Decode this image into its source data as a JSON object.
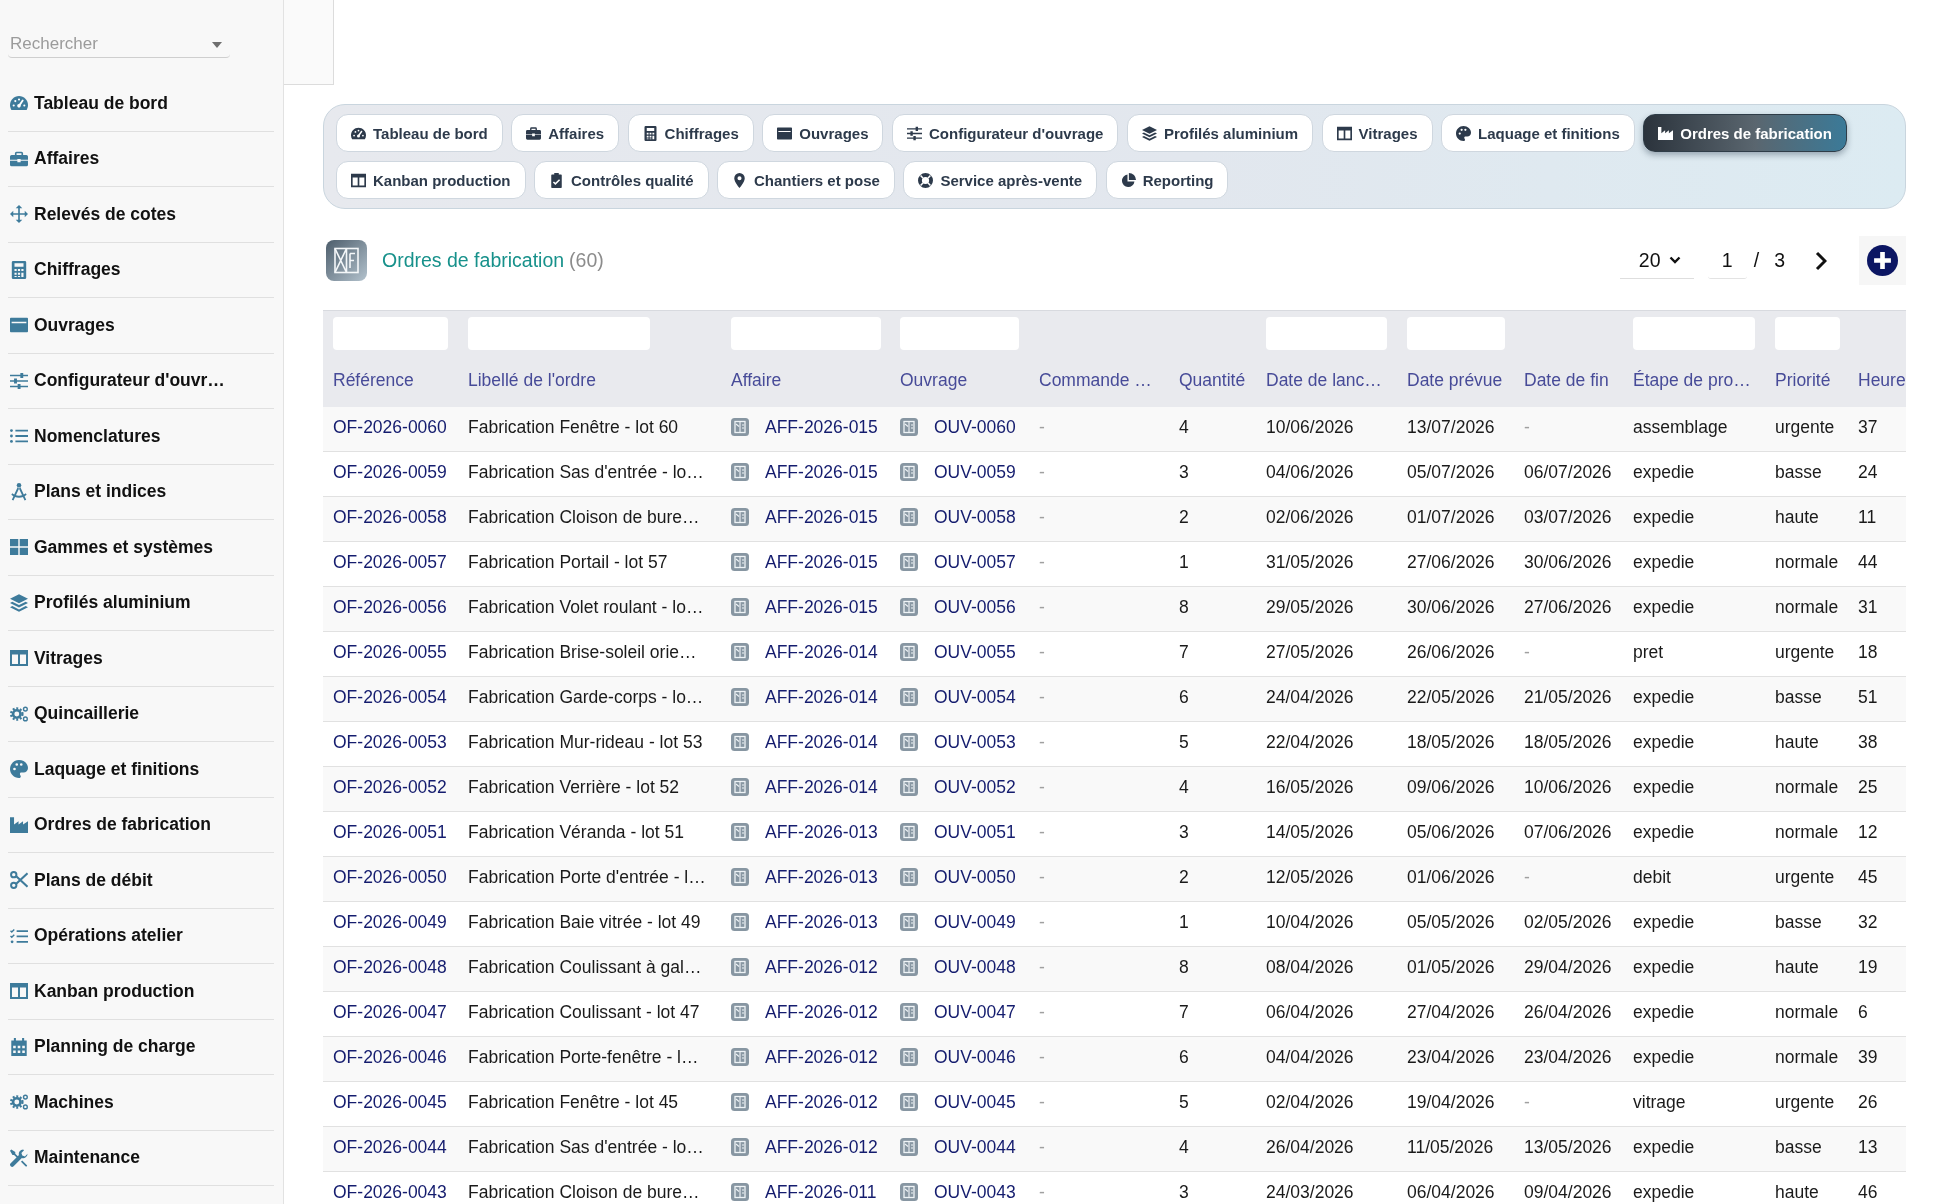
{
  "sidebar": {
    "search": {
      "placeholder": "Rechercher"
    },
    "items": [
      {
        "label": "Tableau de bord"
      },
      {
        "label": "Affaires"
      },
      {
        "label": "Relevés de cotes"
      },
      {
        "label": "Chiffrages"
      },
      {
        "label": "Ouvrages"
      },
      {
        "label": "Configurateur d'ouvr…"
      },
      {
        "label": "Nomenclatures"
      },
      {
        "label": "Plans et indices"
      },
      {
        "label": "Gammes et systèmes"
      },
      {
        "label": "Profilés aluminium"
      },
      {
        "label": "Vitrages"
      },
      {
        "label": "Quincaillerie"
      },
      {
        "label": "Laquage et finitions"
      },
      {
        "label": "Ordres de fabrication"
      },
      {
        "label": "Plans de débit"
      },
      {
        "label": "Opérations atelier"
      },
      {
        "label": "Kanban production"
      },
      {
        "label": "Planning de charge"
      },
      {
        "label": "Machines"
      },
      {
        "label": "Maintenance"
      }
    ]
  },
  "tabs": [
    {
      "label": "Tableau de bord",
      "selected": false
    },
    {
      "label": "Affaires",
      "selected": false
    },
    {
      "label": "Chiffrages",
      "selected": false
    },
    {
      "label": "Ouvrages",
      "selected": false
    },
    {
      "label": "Configurateur d'ouvrage",
      "selected": false
    },
    {
      "label": "Profilés aluminium",
      "selected": false
    },
    {
      "label": "Vitrages",
      "selected": false
    },
    {
      "label": "Laquage et finitions",
      "selected": false
    },
    {
      "label": "Ordres de fabrication",
      "selected": true
    },
    {
      "label": "Kanban production",
      "selected": false
    },
    {
      "label": "Contrôles qualité",
      "selected": false
    },
    {
      "label": "Chantiers et pose",
      "selected": false
    },
    {
      "label": "Service après-vente",
      "selected": false
    },
    {
      "label": "Reporting",
      "selected": false
    }
  ],
  "list_header": {
    "title": "Ordres de fabrication",
    "count": "(60)"
  },
  "pagination": {
    "page_size": "20",
    "page": "1",
    "separator": "/",
    "total_pages": "3"
  },
  "table": {
    "columns": [
      {
        "label": "Référence",
        "kind": "link",
        "filter": true
      },
      {
        "label": "Libellé de l'ordre",
        "kind": "text",
        "filter": true
      },
      {
        "label": "Affaire",
        "kind": "record",
        "filter": true
      },
      {
        "label": "Ouvrage",
        "kind": "record",
        "filter": true
      },
      {
        "label": "Commande …",
        "kind": "text",
        "filter": false
      },
      {
        "label": "Quantité",
        "kind": "text",
        "filter": false
      },
      {
        "label": "Date de lanc…",
        "kind": "text",
        "filter": true
      },
      {
        "label": "Date prévue",
        "kind": "text",
        "filter": true
      },
      {
        "label": "Date de fin",
        "kind": "text",
        "filter": false
      },
      {
        "label": "Étape de pro…",
        "kind": "text",
        "filter": true
      },
      {
        "label": "Priorité",
        "kind": "text",
        "filter": true
      },
      {
        "label": "Heure",
        "kind": "text",
        "filter": false
      }
    ],
    "rows": [
      {
        "cells": [
          "OF-2026-0060",
          "Fabrication Fenêtre - lot 60",
          "AFF-2026-015",
          "OUV-0060",
          "-",
          "4",
          "10/06/2026",
          "13/07/2026",
          "-",
          "assemblage",
          "urgente",
          "37"
        ],
        "muted": [
          false,
          false,
          false,
          false,
          true,
          false,
          false,
          false,
          true,
          false,
          false,
          false
        ]
      },
      {
        "cells": [
          "OF-2026-0059",
          "Fabrication Sas d'entrée - lo…",
          "AFF-2026-015",
          "OUV-0059",
          "-",
          "3",
          "04/06/2026",
          "05/07/2026",
          "06/07/2026",
          "expedie",
          "basse",
          "24"
        ],
        "muted": [
          false,
          false,
          false,
          false,
          true,
          false,
          false,
          false,
          false,
          false,
          false,
          false
        ]
      },
      {
        "cells": [
          "OF-2026-0058",
          "Fabrication Cloison de bure…",
          "AFF-2026-015",
          "OUV-0058",
          "-",
          "2",
          "02/06/2026",
          "01/07/2026",
          "03/07/2026",
          "expedie",
          "haute",
          "11"
        ],
        "muted": [
          false,
          false,
          false,
          false,
          true,
          false,
          false,
          false,
          false,
          false,
          false,
          false
        ]
      },
      {
        "cells": [
          "OF-2026-0057",
          "Fabrication Portail - lot 57",
          "AFF-2026-015",
          "OUV-0057",
          "-",
          "1",
          "31/05/2026",
          "27/06/2026",
          "30/06/2026",
          "expedie",
          "normale",
          "44"
        ],
        "muted": [
          false,
          false,
          false,
          false,
          true,
          false,
          false,
          false,
          false,
          false,
          false,
          false
        ]
      },
      {
        "cells": [
          "OF-2026-0056",
          "Fabrication Volet roulant - lo…",
          "AFF-2026-015",
          "OUV-0056",
          "-",
          "8",
          "29/05/2026",
          "30/06/2026",
          "27/06/2026",
          "expedie",
          "normale",
          "31"
        ],
        "muted": [
          false,
          false,
          false,
          false,
          true,
          false,
          false,
          false,
          false,
          false,
          false,
          false
        ]
      },
      {
        "cells": [
          "OF-2026-0055",
          "Fabrication Brise-soleil orie…",
          "AFF-2026-014",
          "OUV-0055",
          "-",
          "7",
          "27/05/2026",
          "26/06/2026",
          "-",
          "pret",
          "urgente",
          "18"
        ],
        "muted": [
          false,
          false,
          false,
          false,
          true,
          false,
          false,
          false,
          true,
          false,
          false,
          false
        ]
      },
      {
        "cells": [
          "OF-2026-0054",
          "Fabrication Garde-corps - lo…",
          "AFF-2026-014",
          "OUV-0054",
          "-",
          "6",
          "24/04/2026",
          "22/05/2026",
          "21/05/2026",
          "expedie",
          "basse",
          "51"
        ],
        "muted": [
          false,
          false,
          false,
          false,
          true,
          false,
          false,
          false,
          false,
          false,
          false,
          false
        ]
      },
      {
        "cells": [
          "OF-2026-0053",
          "Fabrication Mur-rideau - lot 53",
          "AFF-2026-014",
          "OUV-0053",
          "-",
          "5",
          "22/04/2026",
          "18/05/2026",
          "18/05/2026",
          "expedie",
          "haute",
          "38"
        ],
        "muted": [
          false,
          false,
          false,
          false,
          true,
          false,
          false,
          false,
          false,
          false,
          false,
          false
        ]
      },
      {
        "cells": [
          "OF-2026-0052",
          "Fabrication Verrière - lot 52",
          "AFF-2026-014",
          "OUV-0052",
          "-",
          "4",
          "16/05/2026",
          "09/06/2026",
          "10/06/2026",
          "expedie",
          "normale",
          "25"
        ],
        "muted": [
          false,
          false,
          false,
          false,
          true,
          false,
          false,
          false,
          false,
          false,
          false,
          false
        ]
      },
      {
        "cells": [
          "OF-2026-0051",
          "Fabrication Véranda - lot 51",
          "AFF-2026-013",
          "OUV-0051",
          "-",
          "3",
          "14/05/2026",
          "05/06/2026",
          "07/06/2026",
          "expedie",
          "normale",
          "12"
        ],
        "muted": [
          false,
          false,
          false,
          false,
          true,
          false,
          false,
          false,
          false,
          false,
          false,
          false
        ]
      },
      {
        "cells": [
          "OF-2026-0050",
          "Fabrication Porte d'entrée - l…",
          "AFF-2026-013",
          "OUV-0050",
          "-",
          "2",
          "12/05/2026",
          "01/06/2026",
          "-",
          "debit",
          "urgente",
          "45"
        ],
        "muted": [
          false,
          false,
          false,
          false,
          true,
          false,
          false,
          false,
          true,
          false,
          false,
          false
        ]
      },
      {
        "cells": [
          "OF-2026-0049",
          "Fabrication Baie vitrée - lot 49",
          "AFF-2026-013",
          "OUV-0049",
          "-",
          "1",
          "10/04/2026",
          "05/05/2026",
          "02/05/2026",
          "expedie",
          "basse",
          "32"
        ],
        "muted": [
          false,
          false,
          false,
          false,
          true,
          false,
          false,
          false,
          false,
          false,
          false,
          false
        ]
      },
      {
        "cells": [
          "OF-2026-0048",
          "Fabrication Coulissant à gal…",
          "AFF-2026-012",
          "OUV-0048",
          "-",
          "8",
          "08/04/2026",
          "01/05/2026",
          "29/04/2026",
          "expedie",
          "haute",
          "19"
        ],
        "muted": [
          false,
          false,
          false,
          false,
          true,
          false,
          false,
          false,
          false,
          false,
          false,
          false
        ]
      },
      {
        "cells": [
          "OF-2026-0047",
          "Fabrication Coulissant - lot 47",
          "AFF-2026-012",
          "OUV-0047",
          "-",
          "7",
          "06/04/2026",
          "27/04/2026",
          "26/04/2026",
          "expedie",
          "normale",
          "6"
        ],
        "muted": [
          false,
          false,
          false,
          false,
          true,
          false,
          false,
          false,
          false,
          false,
          false,
          false
        ]
      },
      {
        "cells": [
          "OF-2026-0046",
          "Fabrication Porte-fenêtre - l…",
          "AFF-2026-012",
          "OUV-0046",
          "-",
          "6",
          "04/04/2026",
          "23/04/2026",
          "23/04/2026",
          "expedie",
          "normale",
          "39"
        ],
        "muted": [
          false,
          false,
          false,
          false,
          true,
          false,
          false,
          false,
          false,
          false,
          false,
          false
        ]
      },
      {
        "cells": [
          "OF-2026-0045",
          "Fabrication Fenêtre - lot 45",
          "AFF-2026-012",
          "OUV-0045",
          "-",
          "5",
          "02/04/2026",
          "19/04/2026",
          "-",
          "vitrage",
          "urgente",
          "26"
        ],
        "muted": [
          false,
          false,
          false,
          false,
          true,
          false,
          false,
          false,
          true,
          false,
          false,
          false
        ]
      },
      {
        "cells": [
          "OF-2026-0044",
          "Fabrication Sas d'entrée - lo…",
          "AFF-2026-012",
          "OUV-0044",
          "-",
          "4",
          "26/04/2026",
          "11/05/2026",
          "13/05/2026",
          "expedie",
          "basse",
          "13"
        ],
        "muted": [
          false,
          false,
          false,
          false,
          true,
          false,
          false,
          false,
          false,
          false,
          false,
          false
        ]
      },
      {
        "cells": [
          "OF-2026-0043",
          "Fabrication Cloison de bure…",
          "AFF-2026-011",
          "OUV-0043",
          "-",
          "3",
          "24/03/2026",
          "06/04/2026",
          "09/04/2026",
          "expedie",
          "haute",
          "46"
        ],
        "muted": [
          false,
          false,
          false,
          false,
          true,
          false,
          false,
          false,
          false,
          false,
          false,
          false
        ]
      }
    ]
  }
}
